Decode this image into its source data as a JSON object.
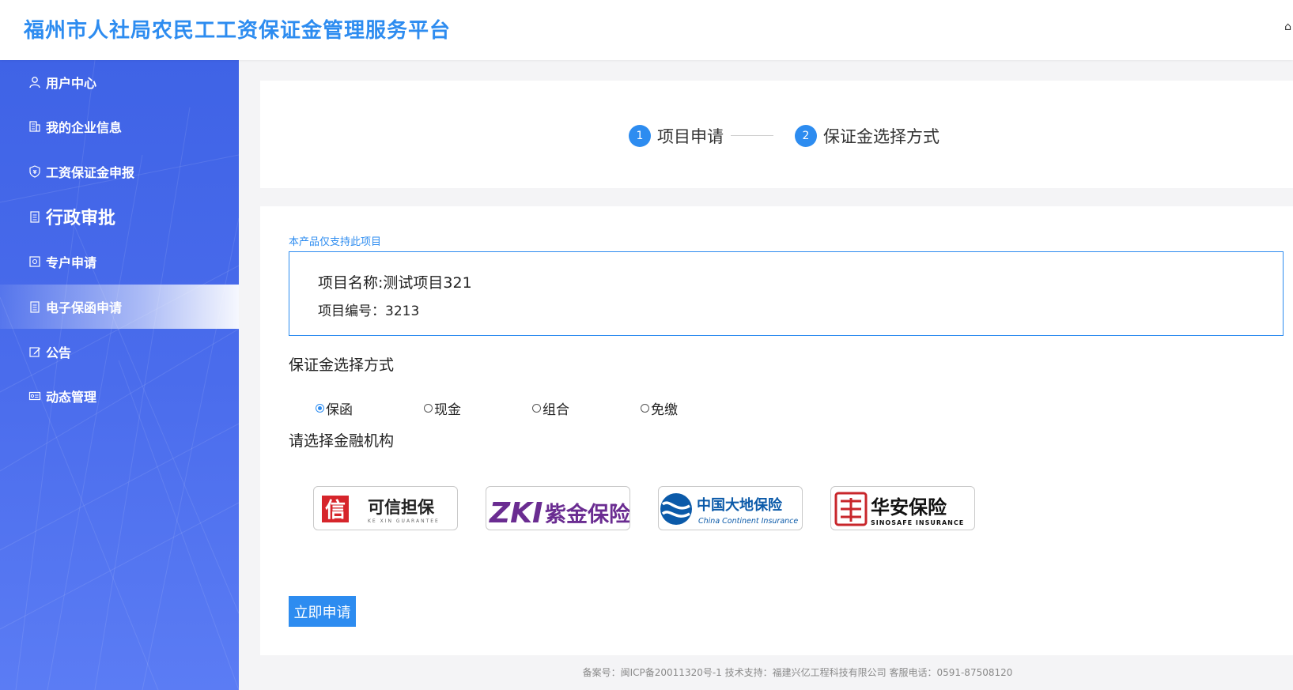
{
  "header": {
    "title": "福州市人社局农民工工资保证金管理服务平台",
    "edge_glyph": "⌂"
  },
  "sidebar": {
    "items": [
      {
        "label": "用户中心",
        "icon": "user-icon"
      },
      {
        "label": "我的企业信息",
        "icon": "building-icon"
      },
      {
        "label": "工资保证金申报",
        "icon": "shield-icon"
      },
      {
        "label": "行政审批",
        "icon": "clipboard-icon"
      },
      {
        "label": "专户申请",
        "icon": "account-icon"
      },
      {
        "label": "电子保函申请",
        "icon": "document-icon",
        "active": true
      },
      {
        "label": "公告",
        "icon": "edit-icon"
      },
      {
        "label": "动态管理",
        "icon": "card-icon"
      }
    ]
  },
  "steps": [
    {
      "num": "1",
      "label": "项目申请"
    },
    {
      "num": "2",
      "label": "保证金选择方式"
    }
  ],
  "project": {
    "hint": "本产品仅支持此项目",
    "name": "项目名称:测试项目321",
    "code": "项目编号：3213"
  },
  "deposit": {
    "title": "保证金选择方式",
    "options": [
      {
        "label": "保函",
        "checked": true
      },
      {
        "label": "现金",
        "checked": false
      },
      {
        "label": "组合",
        "checked": false
      },
      {
        "label": "免缴",
        "checked": false
      }
    ]
  },
  "institutions": {
    "title": "请选择金融机构",
    "items": [
      {
        "name": "可信担保",
        "sub": "KE XIN GUARANTEE",
        "mark": "信",
        "color": "#d6252b"
      },
      {
        "name": "紫金保险",
        "mark": "ZKI",
        "color": "#6a2c91"
      },
      {
        "name": "中国大地保险",
        "sub": "China Continent Insurance",
        "color": "#0b5aa9"
      },
      {
        "name": "华安保险",
        "sub": "SINOSAFE INSURANCE",
        "color": "#c8262b"
      }
    ]
  },
  "actions": {
    "apply": "立即申请"
  },
  "footer": {
    "text": "备案号：闽ICP备20011320号-1 技术支持：福建兴亿工程科技有限公司 客服电话：0591-87508120"
  },
  "colors": {
    "primary": "#2d8cf0",
    "sidebar": "#4a6cec"
  }
}
